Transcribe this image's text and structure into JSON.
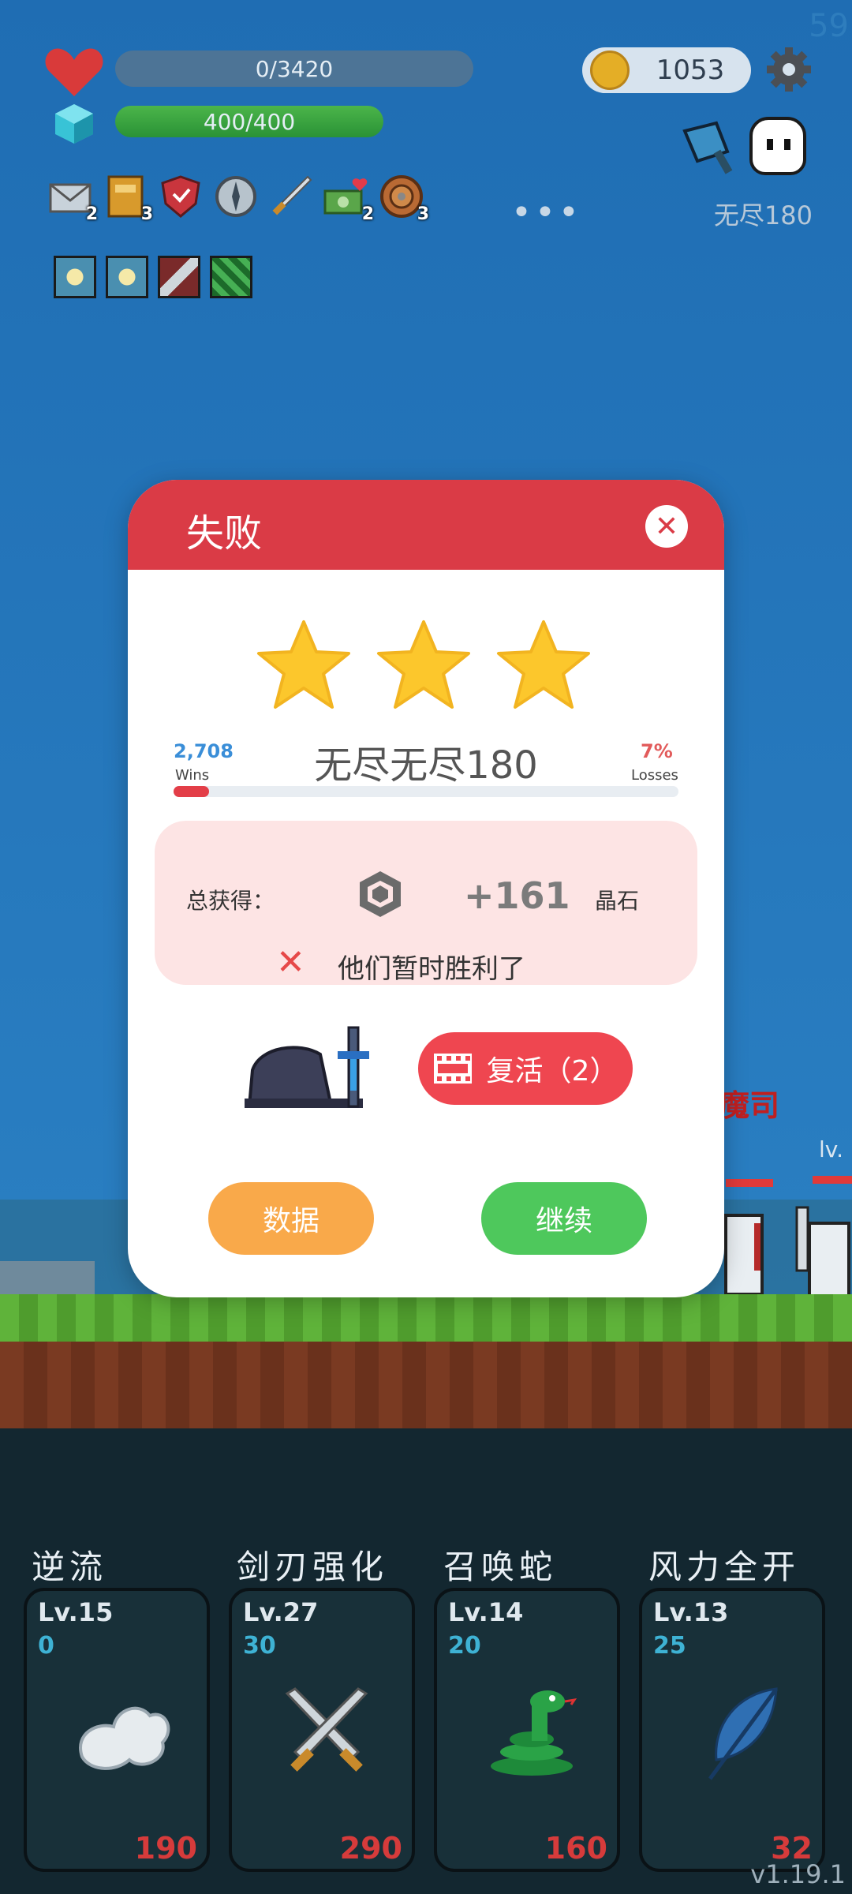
{
  "fps": "59",
  "hud": {
    "hp": "0/3420",
    "mp": "400/400",
    "coins": "1053",
    "stage": "无尽180",
    "items": [
      {
        "icon": "mail-icon",
        "count": "2"
      },
      {
        "icon": "book-icon",
        "count": "3"
      },
      {
        "icon": "shield-icon",
        "count": ""
      },
      {
        "icon": "compass-icon",
        "count": ""
      },
      {
        "icon": "sword-icon",
        "count": ""
      },
      {
        "icon": "cash-heart-icon",
        "count": "2"
      },
      {
        "icon": "round-shield-icon",
        "count": "3"
      }
    ],
    "more": "•••"
  },
  "scene": {
    "enemy_name": "魔司",
    "enemy_level": "lv."
  },
  "modal": {
    "title": "失败",
    "stars": 3,
    "wins_value": "2,708",
    "wins_label": "Wins",
    "losses_value": "7%",
    "losses_label": "Losses",
    "stage_name": "无尽无尽180",
    "progress": 0.07,
    "reward_label": "总获得：",
    "reward_value": "+161",
    "reward_unit": "晶石",
    "result_message": "他们暂时胜利了",
    "revive_label": "复活（2）",
    "data_button": "数据",
    "continue_button": "继续"
  },
  "skills": [
    {
      "title": "逆流",
      "level": "Lv.15",
      "sub": "0",
      "cost": "190",
      "icon": "cloud-wing-icon"
    },
    {
      "title": "剑刃强化",
      "level": "Lv.27",
      "sub": "30",
      "cost": "290",
      "icon": "crossed-swords-icon"
    },
    {
      "title": "召唤蛇",
      "level": "Lv.14",
      "sub": "20",
      "cost": "160",
      "icon": "snake-icon"
    },
    {
      "title": "风力全开",
      "level": "Lv.13",
      "sub": "25",
      "cost": "32",
      "icon": "feather-icon"
    }
  ],
  "version": "v1.19.1",
  "colors": {
    "modal_header": "#da3b46",
    "revive": "#ef4650",
    "data_btn": "#f9a94a",
    "continue_btn": "#4ec85c"
  }
}
